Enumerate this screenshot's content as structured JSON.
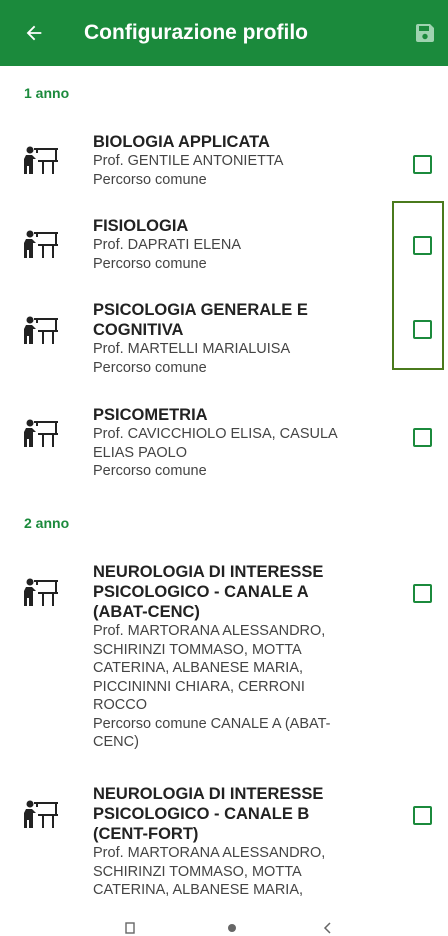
{
  "app_bar": {
    "title": "Configurazione profilo",
    "back_icon": "arrow-left-icon",
    "save_icon": "floppy-disk-icon",
    "color": "#1b8a3c"
  },
  "sections": [
    {
      "label": "1 anno",
      "courses": [
        {
          "name": "BIOLOGIA APPLICATA",
          "details": [
            "Prof. GENTILE ANTONIETTA",
            "Percorso comune"
          ],
          "checked": false
        },
        {
          "name": "FISIOLOGIA",
          "details": [
            "Prof. DAPRATI ELENA",
            "Percorso comune"
          ],
          "checked": false
        },
        {
          "name": "PSICOLOGIA GENERALE E COGNITIVA",
          "details": [
            "Prof. MARTELLI MARIALUISA",
            "Percorso comune"
          ],
          "checked": false
        },
        {
          "name": "PSICOMETRIA",
          "details": [
            "Prof. CAVICCHIOLO ELISA, CASULA ELIAS PAOLO",
            "Percorso comune"
          ],
          "checked": false
        }
      ]
    },
    {
      "label": "2 anno",
      "courses": [
        {
          "name": "NEUROLOGIA DI INTERESSE PSICOLOGICO - CANALE A (ABAT-CENC)",
          "details": [
            "Prof. MARTORANA ALESSANDRO, SCHIRINZI TOMMASO, MOTTA CATERINA, ALBANESE MARIA, PICCININNI CHIARA, CERRONI ROCCO",
            "Percorso comune CANALE A (ABAT-CENC)"
          ],
          "checked": false
        },
        {
          "name": "NEUROLOGIA DI INTERESSE PSICOLOGICO - CANALE B (CENT-FORT)",
          "details": [
            "Prof. MARTORANA ALESSANDRO, SCHIRINZI TOMMASO, MOTTA CATERINA, ALBANESE MARIA,"
          ],
          "checked": false
        }
      ]
    }
  ],
  "course_icon": "teacher-at-board-icon",
  "nav_bar": {
    "buttons": [
      "recents-icon",
      "home-icon",
      "back-icon"
    ]
  }
}
